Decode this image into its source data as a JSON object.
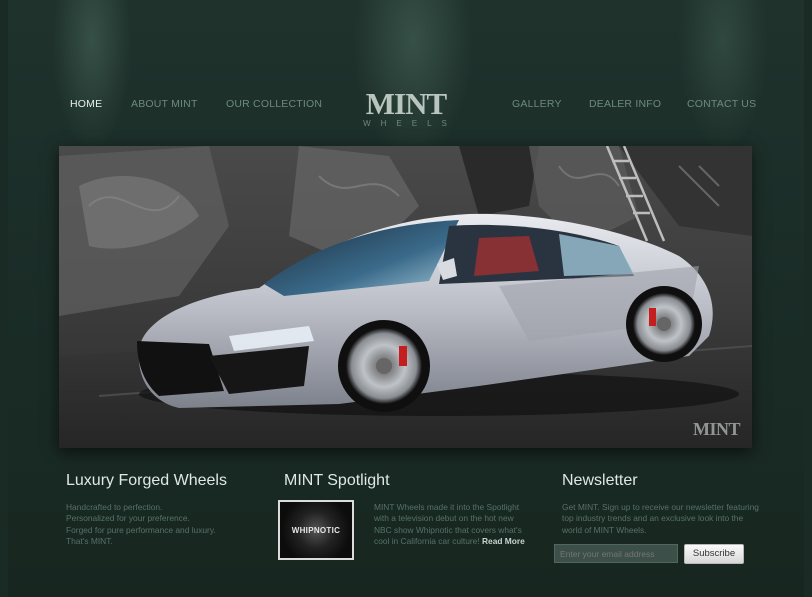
{
  "nav": {
    "home": "HOME",
    "about": "ABOUT MINT",
    "collection": "OUR COLLECTION",
    "gallery": "GALLERY",
    "dealer": "DEALER INFO",
    "contact": "CONTACT US"
  },
  "logo": {
    "main": "MINT",
    "sub": "WHEELS"
  },
  "hero": {
    "watermark": "MINT"
  },
  "luxury": {
    "title": "Luxury Forged Wheels",
    "lines": [
      "Handcrafted to perfection.",
      "Personalized for your preference.",
      "Forged for pure performance and luxury.",
      "That's MINT."
    ]
  },
  "spotlight": {
    "title": "MINT Spotlight",
    "thumb_label": "WHIPNOTIC",
    "text": "MINT Wheels made it into the Spotlight with a television debut on the hot new NBC show Whipnotic that covers what's cool in California car culture!",
    "read_more": "Read More"
  },
  "newsletter": {
    "title": "Newsletter",
    "text": "Get MINT. Sign up to receive our newsletter featuring top industry trends and an exclusive look into the world of MINT Wheels.",
    "placeholder": "Enter your email address",
    "button": "Subscribe"
  },
  "colors": {
    "background": "#1a2a25",
    "nav_active": "#e7f0ec",
    "nav": "#6d8a80"
  }
}
